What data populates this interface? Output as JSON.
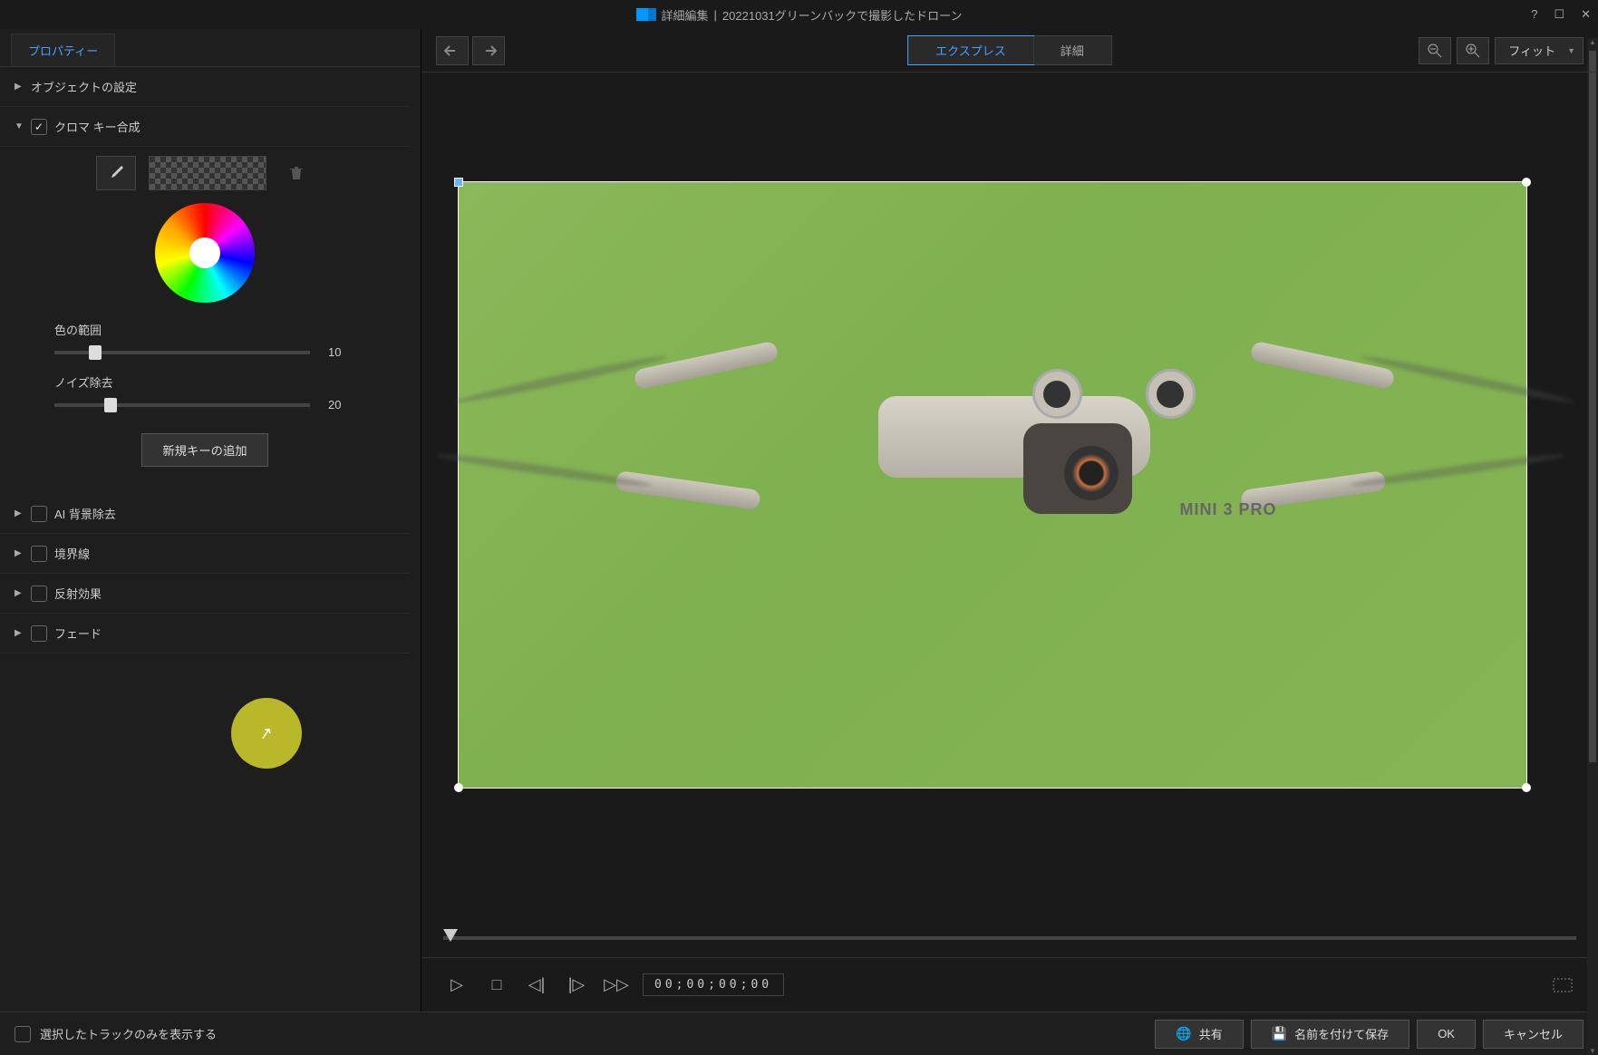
{
  "titlebar": {
    "app_label": "詳細編集",
    "separator": "|",
    "filename": "20221031グリーンバックで撮影したドローン"
  },
  "left": {
    "tab_label": "プロパティー",
    "sections": {
      "object_settings": "オブジェクトの設定",
      "chroma_key": "クロマ キー合成",
      "ai_bg_remove": "AI 背景除去",
      "border": "境界線",
      "reflection": "反射効果",
      "fade": "フェード"
    },
    "chroma": {
      "color_range_label": "色の範囲",
      "color_range_value": "10",
      "noise_label": "ノイズ除去",
      "noise_value": "20",
      "add_key_button": "新規キーの追加"
    }
  },
  "toolbar": {
    "express_label": "エクスプレス",
    "detail_label": "詳細",
    "fit_label": "フィット"
  },
  "playback": {
    "timecode": "00;00;00;00"
  },
  "preview": {
    "drone_model": "MINI 3 PRO"
  },
  "footer": {
    "show_selected_only": "選択したトラックのみを表示する",
    "share": "共有",
    "save_as": "名前を付けて保存",
    "ok": "OK",
    "cancel": "キャンセル"
  }
}
